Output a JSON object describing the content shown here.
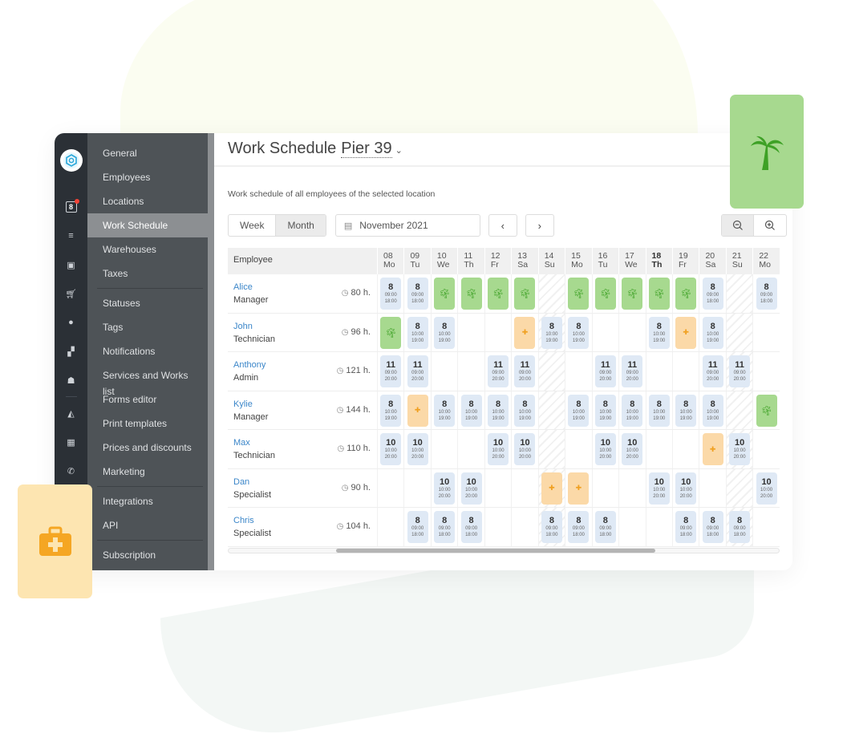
{
  "sidebar": {
    "rail_icons": [
      "calendar-badge-icon",
      "filter-icon",
      "inbox-icon",
      "cart-icon",
      "dollar-icon",
      "sitemap-icon",
      "users-icon",
      "chart-icon",
      "table-icon",
      "phone-icon"
    ],
    "calendar_badge": "8",
    "groups": [
      [
        "General",
        "Employees",
        "Locations",
        "Work Schedule",
        "Warehouses",
        "Taxes"
      ],
      [
        "Statuses",
        "Tags",
        "Notifications",
        "Services and Works list",
        "Forms editor",
        "Print templates",
        "Prices and discounts",
        "Marketing"
      ],
      [
        "Integrations",
        "API"
      ],
      [
        "Subscription"
      ]
    ],
    "active": "Work Schedule"
  },
  "header": {
    "title": "Work Schedule",
    "location": "Pier 39"
  },
  "subtitle": "Work schedule of all employees of the selected location",
  "controls": {
    "view_week": "Week",
    "view_month": "Month",
    "active_view": "Month",
    "date": "November 2021",
    "prev": "‹",
    "next": "›",
    "zoom_out": "−",
    "zoom_in": "+"
  },
  "table": {
    "employee_header": "Employee",
    "today": "18",
    "days": [
      {
        "d": "08",
        "w": "Mo"
      },
      {
        "d": "09",
        "w": "Tu"
      },
      {
        "d": "10",
        "w": "We"
      },
      {
        "d": "11",
        "w": "Th"
      },
      {
        "d": "12",
        "w": "Fr"
      },
      {
        "d": "13",
        "w": "Sa"
      },
      {
        "d": "14",
        "w": "Su",
        "weekend": true
      },
      {
        "d": "15",
        "w": "Mo"
      },
      {
        "d": "16",
        "w": "Tu"
      },
      {
        "d": "17",
        "w": "We"
      },
      {
        "d": "18",
        "w": "Th"
      },
      {
        "d": "19",
        "w": "Fr"
      },
      {
        "d": "20",
        "w": "Sa"
      },
      {
        "d": "21",
        "w": "Su",
        "weekend": true
      },
      {
        "d": "22",
        "w": "Mo"
      }
    ],
    "employees": [
      {
        "name": "Alice",
        "role": "Manager",
        "hours": "80 h.",
        "cells": [
          "S:8:09:00:18:00",
          "S:8:09:00:18:00",
          "V",
          "V",
          "V",
          "V",
          "",
          "V",
          "V",
          "V",
          "V",
          "V",
          "S:8:09:00:18:00",
          "",
          "S:8:09:00:18:00"
        ]
      },
      {
        "name": "John",
        "role": "Technician",
        "hours": "96 h.",
        "cells": [
          "V",
          "S:8:10:00:19:00",
          "S:8:10:00:19:00",
          "",
          "",
          "K",
          "S:8:10:00:19:00",
          "S:8:10:00:19:00",
          "",
          "",
          "S:8:10:00:19:00",
          "K",
          "S:8:10:00:19:00",
          "",
          ""
        ]
      },
      {
        "name": "Anthony",
        "role": "Admin",
        "hours": "121 h.",
        "cells": [
          "S:11:09:00:20:00",
          "S:11:09:00:20:00",
          "",
          "",
          "S:11:09:00:20:00",
          "S:11:09:00:20:00",
          "",
          "",
          "S:11:09:00:20:00",
          "S:11:09:00:20:00",
          "",
          "",
          "S:11:09:00:20:00",
          "S:11:09:00:20:00",
          ""
        ]
      },
      {
        "name": "Kylie",
        "role": "Manager",
        "hours": "144 h.",
        "cells": [
          "S:8:10:00:19:00",
          "K",
          "S:8:10:00:19:00",
          "S:8:10:00:19:00",
          "S:8:10:00:19:00",
          "S:8:10:00:19:00",
          "",
          "S:8:10:00:19:00",
          "S:8:10:00:19:00",
          "S:8:10:00:19:00",
          "S:8:10:00:19:00",
          "S:8:10:00:19:00",
          "S:8:10:00:19:00",
          "",
          "V"
        ]
      },
      {
        "name": "Max",
        "role": "Technician",
        "hours": "110 h.",
        "cells": [
          "S:10:10:00:20:00",
          "S:10:10:00:20:00",
          "",
          "",
          "S:10:10:00:20:00",
          "S:10:10:00:20:00",
          "",
          "",
          "S:10:10:00:20:00",
          "S:10:10:00:20:00",
          "",
          "",
          "K",
          "S:10:10:00:20:00",
          ""
        ]
      },
      {
        "name": "Dan",
        "role": "Specialist",
        "hours": "90 h.",
        "cells": [
          "",
          "",
          "S:10:10:00:20:00",
          "S:10:10:00:20:00",
          "",
          "",
          "K",
          "K",
          "",
          "",
          "S:10:10:00:20:00",
          "S:10:10:00:20:00",
          "",
          "",
          "S:10:10:00:20:00"
        ]
      },
      {
        "name": "Chris",
        "role": "Specialist",
        "hours": "104 h.",
        "cells": [
          "",
          "S:8:09:00:18:00",
          "S:8:09:00:18:00",
          "S:8:09:00:18:00",
          "",
          "",
          "S:8:09:00:18:00",
          "S:8:09:00:18:00",
          "S:8:09:00:18:00",
          "",
          "",
          "S:8:09:00:18:00",
          "S:8:09:00:18:00",
          "S:8:09:00:18:00",
          ""
        ]
      }
    ]
  },
  "scroll": {
    "position_fraction": 0.2,
    "visible_fraction": 0.58
  },
  "colors": {
    "shift": "#dfe9f5",
    "vacation": "#a7d98f",
    "vacation_icon": "#3ea126",
    "sick": "#fbd9a8",
    "sick_icon": "#f0a020",
    "link": "#3b86c9"
  }
}
